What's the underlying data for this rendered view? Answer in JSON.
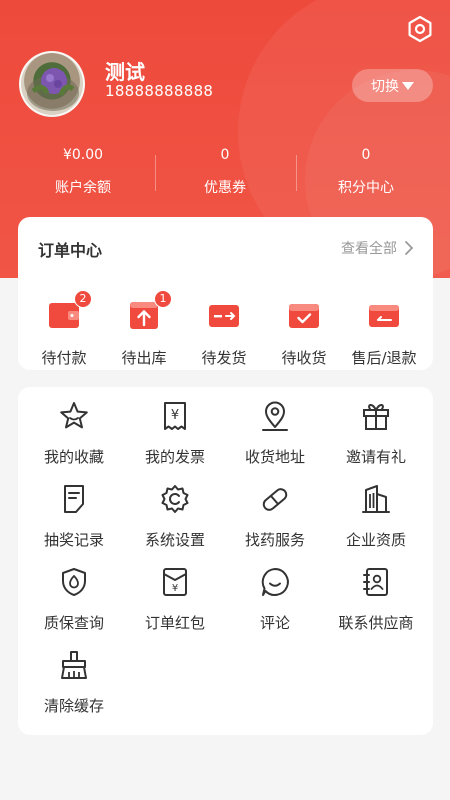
{
  "colors": {
    "brand": "#EE4A3C",
    "text": "#333333",
    "muted": "#999999",
    "background": "#F5F5F5"
  },
  "header": {
    "settings_icon": "settings-icon",
    "user": {
      "name": "测试",
      "phone": "18888888888"
    },
    "switch_label": "切换"
  },
  "stats": [
    {
      "value": "¥0.00",
      "label": "账户余额"
    },
    {
      "value": "0",
      "label": "优惠券"
    },
    {
      "value": "0",
      "label": "积分中心"
    }
  ],
  "orders": {
    "title": "订单中心",
    "view_all": "查看全部",
    "items": [
      {
        "label": "待付款",
        "icon": "wallet-icon",
        "badge": "2"
      },
      {
        "label": "待出库",
        "icon": "upload-box-icon",
        "badge": "1"
      },
      {
        "label": "待发货",
        "icon": "truck-card-icon"
      },
      {
        "label": "待收货",
        "icon": "box-check-icon"
      },
      {
        "label": "售后/退款",
        "icon": "refund-icon"
      }
    ]
  },
  "tools": [
    {
      "label": "我的收藏",
      "icon": "star-icon"
    },
    {
      "label": "我的发票",
      "icon": "invoice-icon"
    },
    {
      "label": "收货地址",
      "icon": "location-icon"
    },
    {
      "label": "邀请有礼",
      "icon": "gift-icon"
    },
    {
      "label": "抽奖记录",
      "icon": "document-icon"
    },
    {
      "label": "系统设置",
      "icon": "gear-icon"
    },
    {
      "label": "找药服务",
      "icon": "pill-icon"
    },
    {
      "label": "企业资质",
      "icon": "building-icon"
    },
    {
      "label": "质保查询",
      "icon": "shield-icon"
    },
    {
      "label": "订单红包",
      "icon": "red-envelope-icon"
    },
    {
      "label": "评论",
      "icon": "comment-icon"
    },
    {
      "label": "联系供应商",
      "icon": "contacts-icon"
    },
    {
      "label": "清除缓存",
      "icon": "broom-icon"
    }
  ]
}
